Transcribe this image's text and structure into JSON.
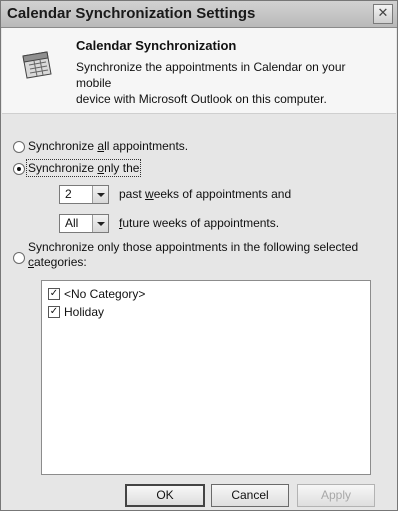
{
  "window": {
    "title": "Calendar Synchronization Settings",
    "close_symbol": "✕"
  },
  "header": {
    "title": "Calendar Synchronization",
    "description_line1": "Synchronize the appointments in Calendar on your mobile",
    "description_line2": "device with Microsoft Outlook on this computer.",
    "icon": "calendar-icon"
  },
  "options": {
    "all": {
      "pre": "Synchronize ",
      "ul": "a",
      "post": "ll appointments."
    },
    "only_the": {
      "pre": "Synchronize ",
      "ul": "o",
      "post": "nly the"
    },
    "past": {
      "value": "2",
      "pre": "past ",
      "ul": "w",
      "post": "eeks of appointments and"
    },
    "future": {
      "value": "All",
      "ul": "f",
      "post": "uture weeks of appointments."
    },
    "categories": {
      "line1": "Synchronize only those appointments in the following selected",
      "ul": "c",
      "line2_post": "ategories:"
    },
    "selected": "only_the"
  },
  "categories_list": [
    {
      "label": "<No Category>",
      "checked": true
    },
    {
      "label": "Holiday",
      "checked": true
    }
  ],
  "buttons": {
    "ok": "OK",
    "cancel": "Cancel",
    "apply": "Apply"
  }
}
